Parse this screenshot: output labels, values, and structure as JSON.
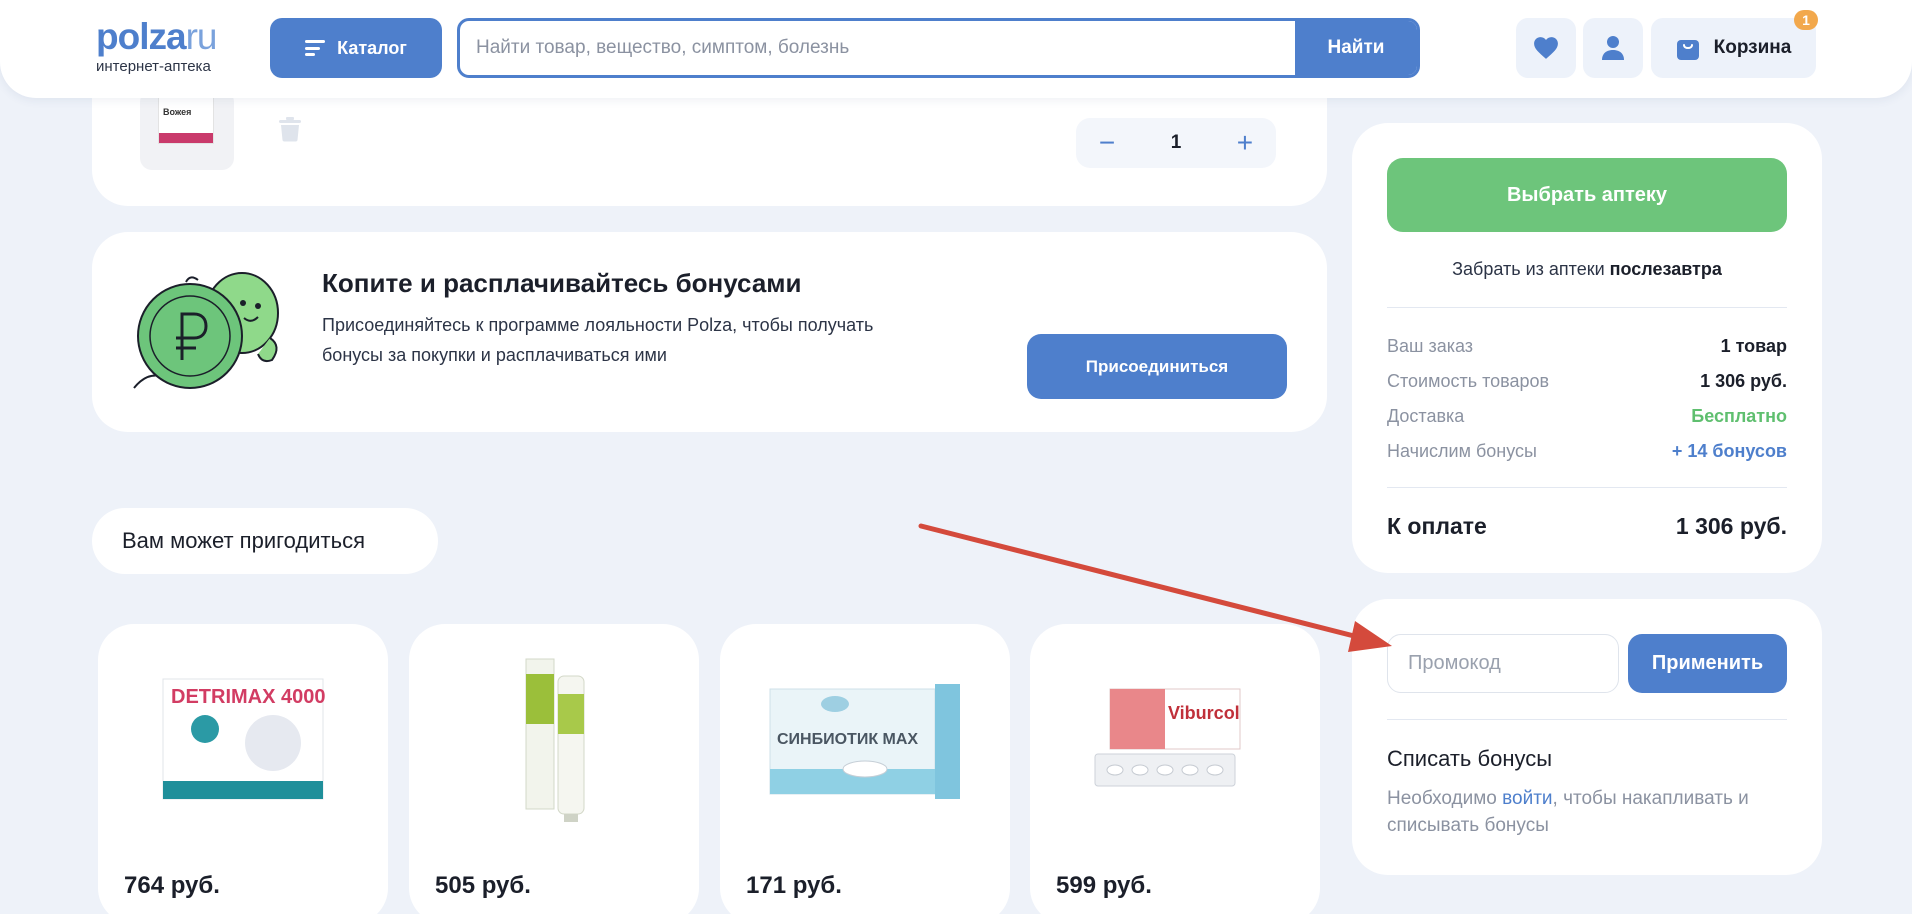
{
  "header": {
    "logo_main": "polza",
    "logo_ru": "ru",
    "logo_sub": "интернет-аптека",
    "catalog_label": "Каталог",
    "search_placeholder": "Найти товар, вещество, симптом, болезнь",
    "search_button": "Найти",
    "cart_label": "Корзина",
    "cart_count": "1"
  },
  "cart_item": {
    "thumb_text": "Вожея",
    "quantity": "1",
    "minus": "−",
    "plus": "+"
  },
  "bonus_banner": {
    "title": "Копите и расплачивайтесь бонусами",
    "text": "Присоединяйтесь к программе лояльности Polza, чтобы получать бонусы за покупки и расплачиваться ими",
    "join_button": "Присоединиться"
  },
  "recommendations": {
    "title": "Вам может пригодиться",
    "products": [
      {
        "name": "DETRIMAX 4000",
        "price": "764 руб."
      },
      {
        "name": "tube cream",
        "price": "505 руб."
      },
      {
        "name": "СИНБИОТИК MAX",
        "price": "171 руб."
      },
      {
        "name": "Viburcol",
        "price": "599 руб."
      }
    ]
  },
  "summary": {
    "pick_button": "Выбрать аптеку",
    "pickup_prefix": "Забрать из аптеки ",
    "pickup_when": "послезавтра",
    "rows": [
      {
        "k": "Ваш заказ",
        "v": "1 товар"
      },
      {
        "k": "Стоимость товаров",
        "v": "1 306 руб."
      },
      {
        "k": "Доставка",
        "v": "Бесплатно"
      },
      {
        "k": "Начислим бонусы",
        "v": "+ 14 бонусов"
      }
    ],
    "total_label": "К оплате",
    "total_value": "1 306 руб."
  },
  "promo": {
    "placeholder": "Промокод",
    "apply_button": "Применить",
    "bonus_title": "Списать бонусы",
    "bonus_text_1": "Необходимо ",
    "bonus_link": "войти",
    "bonus_text_2": ", чтобы накапливать и списывать бонусы"
  },
  "colors": {
    "accent": "#4e7fcc",
    "green": "#6dc57b",
    "arrow": "#d44a3c",
    "background": "#eef2f9"
  }
}
